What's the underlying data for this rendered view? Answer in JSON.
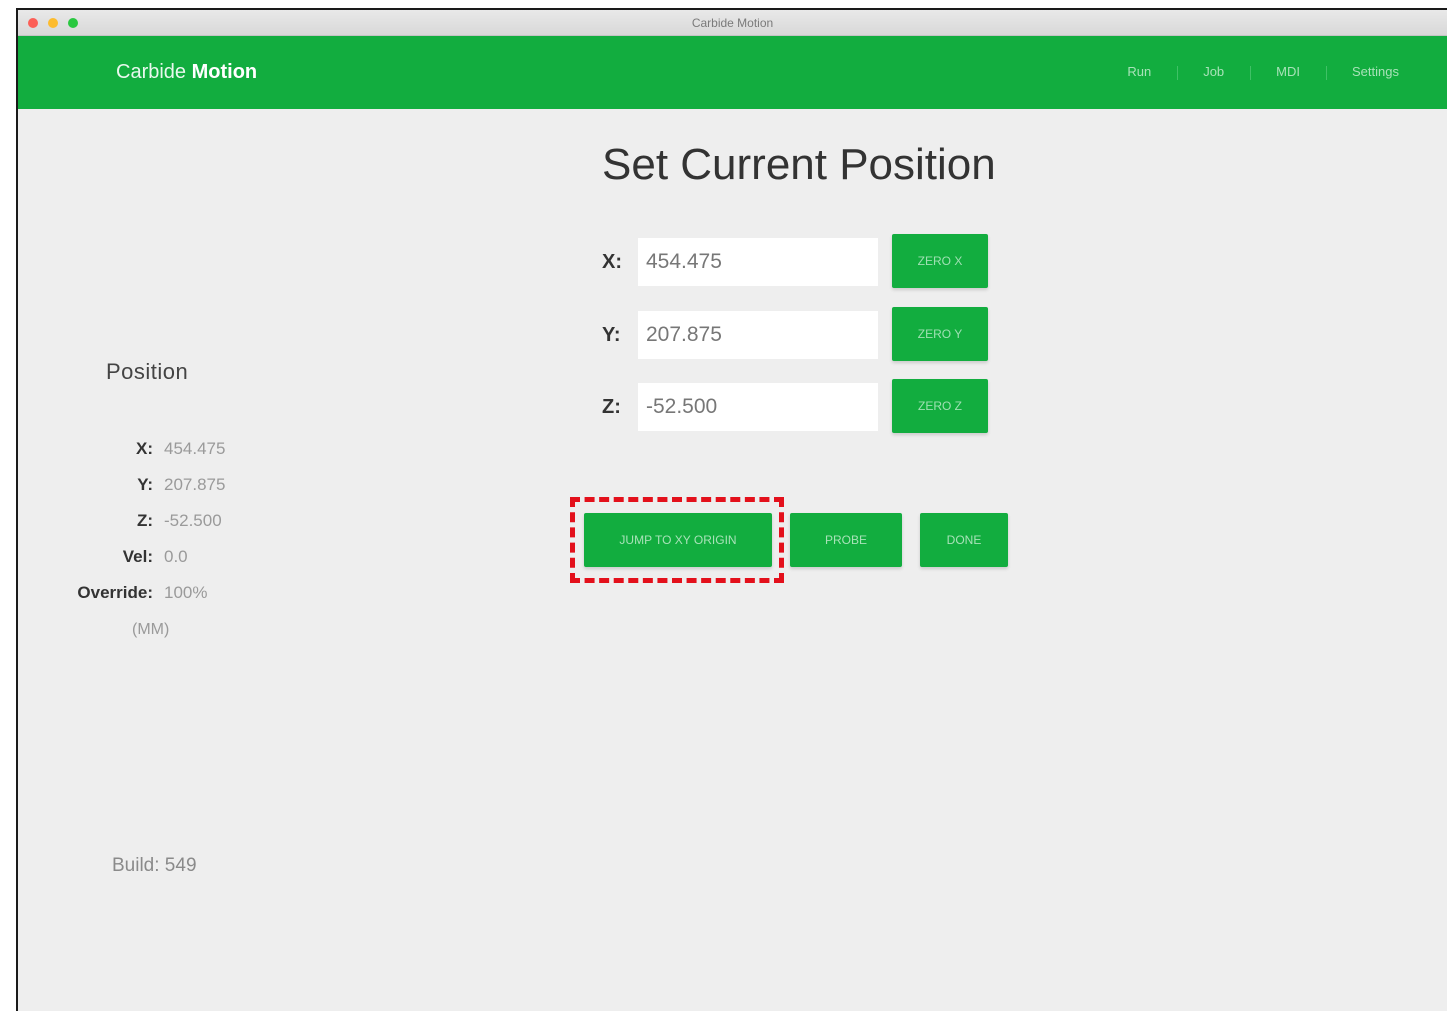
{
  "window": {
    "title": "Carbide Motion"
  },
  "navbar": {
    "brand_light": "Carbide",
    "brand_bold": "Motion",
    "links": [
      "Run",
      "Job",
      "MDI",
      "Settings"
    ]
  },
  "sidebar": {
    "heading": "Position",
    "rows": [
      {
        "label": "X:",
        "value": "454.475"
      },
      {
        "label": "Y:",
        "value": "207.875"
      },
      {
        "label": "Z:",
        "value": "-52.500"
      },
      {
        "label": "Vel:",
        "value": "0.0"
      },
      {
        "label": "Override:",
        "value": "100%"
      }
    ],
    "units": "(MM)",
    "build": "Build: 549"
  },
  "main": {
    "title": "Set Current Position",
    "axes": [
      {
        "label": "X:",
        "value": "454.475",
        "button": "ZERO X"
      },
      {
        "label": "Y:",
        "value": "207.875",
        "button": "ZERO Y"
      },
      {
        "label": "Z:",
        "value": "-52.500",
        "button": "ZERO Z"
      }
    ],
    "actions": {
      "jump_label": "JUMP TO XY ORIGIN",
      "probe_label": "PROBE",
      "done_label": "DONE"
    }
  },
  "colors": {
    "brand_green": "#12ad3f",
    "highlight_red": "#e3101b",
    "background": "#eeeeee"
  }
}
